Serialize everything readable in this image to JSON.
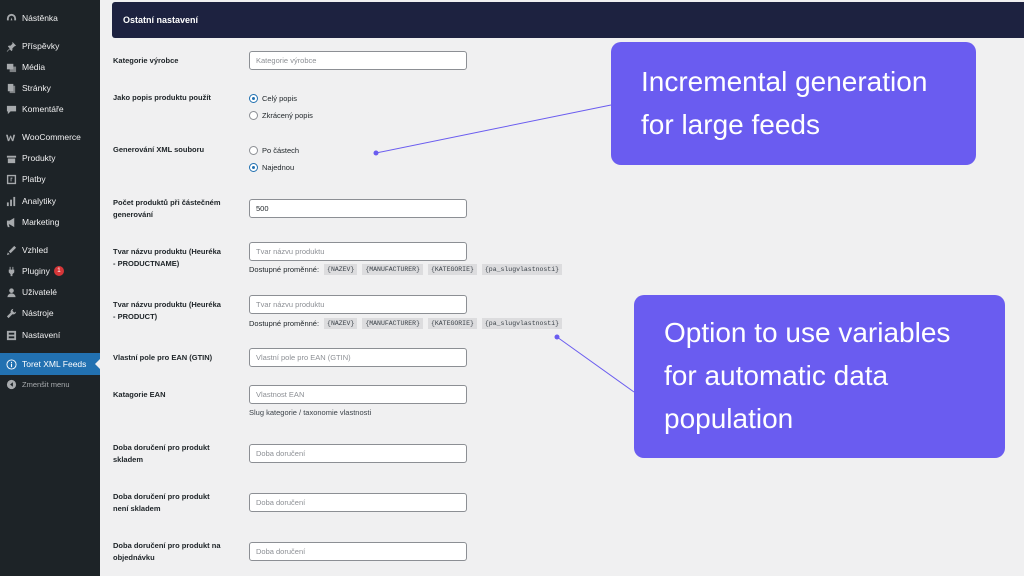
{
  "sidebar": {
    "items": [
      {
        "label": "Nástěnka",
        "icon": "dashboard-icon"
      },
      {
        "label": "Příspěvky",
        "icon": "pin-icon"
      },
      {
        "label": "Média",
        "icon": "media-icon"
      },
      {
        "label": "Stránky",
        "icon": "pages-icon"
      },
      {
        "label": "Komentáře",
        "icon": "comments-icon"
      },
      {
        "label": "WooCommerce",
        "icon": "woocommerce-icon"
      },
      {
        "label": "Produkty",
        "icon": "products-icon"
      },
      {
        "label": "Platby",
        "icon": "payments-icon"
      },
      {
        "label": "Analytiky",
        "icon": "analytics-icon"
      },
      {
        "label": "Marketing",
        "icon": "marketing-icon"
      },
      {
        "label": "Vzhled",
        "icon": "appearance-icon"
      },
      {
        "label": "Pluginy",
        "icon": "plugins-icon",
        "badge": "1"
      },
      {
        "label": "Uživatelé",
        "icon": "users-icon"
      },
      {
        "label": "Nástroje",
        "icon": "tools-icon"
      },
      {
        "label": "Nastavení",
        "icon": "settings-icon"
      },
      {
        "label": "Toret XML Feeds",
        "icon": "info-icon"
      },
      {
        "label": "Zmenšit menu",
        "icon": "collapse-icon"
      }
    ]
  },
  "header": {
    "title": "Ostatní nastavení"
  },
  "form": {
    "manufacturer_category": {
      "label": "Kategorie výrobce",
      "placeholder": "Kategorie výrobce"
    },
    "description": {
      "label": "Jako popis produktu použít",
      "options": [
        "Celý popis",
        "Zkrácený popis"
      ],
      "selected": "Celý popis"
    },
    "xml_generation": {
      "label": "Generování XML souboru",
      "options": [
        "Po částech",
        "Najednou"
      ],
      "selected": "Najednou"
    },
    "partial_count": {
      "label_line1": "Počet produktů při částečném",
      "label_line2": "generování",
      "value": "500"
    },
    "productname": {
      "label_line1": "Tvar názvu produktu (Heuréka",
      "label_line2": "- PRODUCTNAME)",
      "placeholder": "Tvar názvu produktu",
      "vars_label": "Dostupné proměnné:",
      "vars": [
        "{NAZEV}",
        "{MANUFACTURER}",
        "{KATEGORIE}",
        "{pa_slugvlastnosti}"
      ]
    },
    "product": {
      "label_line1": "Tvar názvu produktu (Heuréka",
      "label_line2": "- PRODUCT)",
      "placeholder": "Tvar názvu produktu",
      "vars_label": "Dostupné proměnné:",
      "vars": [
        "{NAZEV}",
        "{MANUFACTURER}",
        "{KATEGORIE}",
        "{pa_slugvlastnosti}"
      ]
    },
    "gtin": {
      "label": "Vlastní pole pro EAN (GTIN)",
      "placeholder": "Vlastní pole pro EAN (GTIN)"
    },
    "ean_category": {
      "label": "Katagorie EAN",
      "placeholder": "Vlastnost EAN",
      "description": "Slug kategorie / taxonomie vlastnosti"
    },
    "delivery_in_stock": {
      "label_line1": "Doba doručení pro produkt",
      "label_line2": "skladem",
      "placeholder": "Doba doručení"
    },
    "delivery_out_of_stock": {
      "label_line1": "Doba doručení pro produkt",
      "label_line2": "není skladem",
      "placeholder": "Doba doručení"
    },
    "delivery_on_order": {
      "label_line1": "Doba doručení pro produkt na",
      "label_line2": "objednávku",
      "placeholder": "Doba doručení"
    }
  },
  "callouts": {
    "incremental": {
      "line1": "Incremental generation",
      "line2": "for large feeds"
    },
    "variables": {
      "line1": "Option to use variables",
      "line2": "for automatic data",
      "line3": "population"
    }
  },
  "colors": {
    "callout": "#6a5cf0",
    "header": "#1d2240",
    "sidebar": "#1d2327",
    "active": "#2271b1"
  }
}
